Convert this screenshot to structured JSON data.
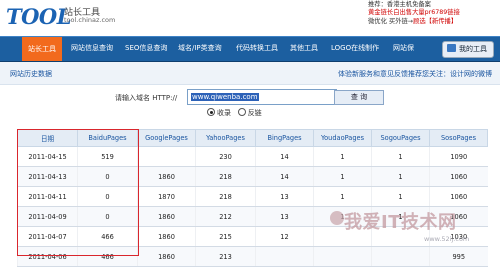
{
  "header": {
    "logo": "TOOL",
    "site_name": "站长工具",
    "site_domain": "tool.chinaz.com",
    "ad": {
      "line1": "推荐：香港主机免备案",
      "line2": "黄金链长白出售大量pr6789链接",
      "line3_prefix": "微优化 买外链→",
      "line3_link": "顾选【新传播】"
    }
  },
  "nav": {
    "items": [
      "站长工具",
      "网站信息查询",
      "SEO信息查询",
      "域名/IP类查询",
      "代码转换工具",
      "其他工具",
      "LOGO在线制作",
      "网站保 "
    ],
    "my_tools": "我的工具"
  },
  "sub_bar": {
    "title": "网站历史数据",
    "notice": "体验新服务和意见反馈推荐您关注：设计网的微博"
  },
  "query": {
    "label": "请输入域名 HTTP://",
    "value": "www.qiwenba.com",
    "button": "查 询",
    "radio_options": [
      "收录",
      "反链"
    ],
    "radio_selected": 0
  },
  "table": {
    "columns": [
      "日期",
      "BaiduPages",
      "GooglePages",
      "YahooPages",
      "BingPages",
      "YoudaoPages",
      "SogouPages",
      "SosoPages"
    ],
    "rows": [
      [
        "2011-04-15",
        "519",
        "",
        "230",
        "14",
        "1",
        "1",
        "1090"
      ],
      [
        "2011-04-13",
        "0",
        "1860",
        "218",
        "14",
        "1",
        "1",
        "1060"
      ],
      [
        "2011-04-11",
        "0",
        "1870",
        "218",
        "13",
        "1",
        "1",
        "1060"
      ],
      [
        "2011-04-09",
        "0",
        "1860",
        "212",
        "13",
        "1",
        "1",
        "1060"
      ],
      [
        "2011-04-07",
        "466",
        "1860",
        "215",
        "12",
        "",
        "",
        "1030"
      ],
      [
        "2011-04-06",
        "466",
        "1860",
        "213",
        "",
        "",
        "",
        "995"
      ]
    ]
  },
  "watermark": {
    "big": "我爱IT技术网",
    "small": "www.52ij.com"
  },
  "colors": {
    "brand_blue": "#1c5fa0",
    "nav_active": "#f26a1d",
    "highlight_red": "#d9262d"
  }
}
